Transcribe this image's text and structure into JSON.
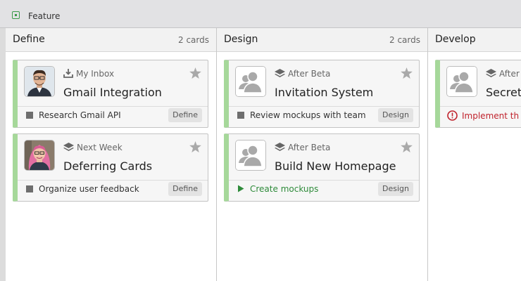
{
  "topbar": {
    "label": "Feature",
    "icon": "feature-square-icon",
    "accent": "#3b9a4a"
  },
  "columns": [
    {
      "title": "Define",
      "count": "2 cards",
      "cards": [
        {
          "group": "My Inbox",
          "group_icon": "inbox-download-icon",
          "title": "Gmail Integration",
          "avatar": "man-photo",
          "task": "Research Gmail API",
          "task_icon": "task-checkbox-icon",
          "tag": "Define"
        },
        {
          "group": "Next Week",
          "group_icon": "layers-icon",
          "title": "Deferring Cards",
          "avatar": "woman-photo",
          "task": "Organize user feedback",
          "task_icon": "task-checkbox-icon",
          "tag": "Define"
        }
      ]
    },
    {
      "title": "Design",
      "count": "2 cards",
      "cards": [
        {
          "group": "After Beta",
          "group_icon": "layers-icon",
          "title": "Invitation System",
          "avatar": "placeholder-users",
          "task": "Review mockups with team",
          "task_icon": "task-checkbox-icon",
          "tag": "Design"
        },
        {
          "group": "After Beta",
          "group_icon": "layers-icon",
          "title": "Build New Homepage",
          "avatar": "placeholder-users",
          "task": "Create mockups",
          "task_icon": "play-icon",
          "tag": "Design"
        }
      ]
    },
    {
      "title": "Develop",
      "cards": [
        {
          "group": "After",
          "group_icon": "layers-icon",
          "title": "Secret",
          "avatar": "placeholder-users",
          "task": "Implement th",
          "task_icon": "alert-circle-icon"
        }
      ]
    }
  ],
  "colors": {
    "card_stripe": "#a6d89a",
    "task_green": "#2e8b3a",
    "task_red": "#c0222c"
  }
}
